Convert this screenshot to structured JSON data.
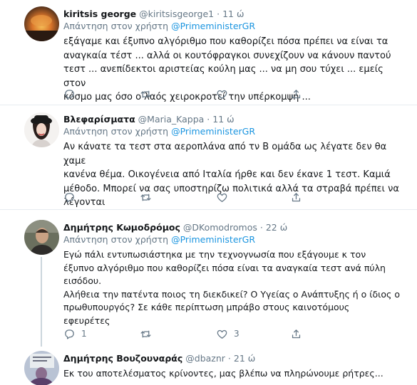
{
  "reply_prefix": "Απάντηση στον χρήστη",
  "tweets": [
    {
      "name": "kiritsis george",
      "handle": "@kiritsisgeorge1",
      "time": "11 ώ",
      "reply_to": "@PrimeministerGR",
      "lines": [
        "εξάγαμε και έξυπνο αλγόριθμο που καθορίζει πόσα πρέπει να είναι τα",
        "αναγκαία τέστ ... αλλά οι κουτόφραγκοι συνεχίζουν να κάνουν παντού",
        "τεστ ... ανεπίδεκτοι αριστείας κούλη μας ... να μη σου τύχει ... εμείς στον",
        "κόσμο μας  όσο ο λαός χειροκροτεί την υπέρκομψη ..."
      ],
      "counts": {
        "replies": "",
        "retweets": "",
        "likes": ""
      }
    },
    {
      "name": "Βλεφαρίσματα",
      "handle": "@Maria_Kappa",
      "time": "11 ώ",
      "reply_to": "@PrimeministerGR",
      "lines": [
        "Αν κάνατε τα τεστ στα αεροπλάνα από τν Β ομάδα ως λέγατε δεν θα χαμε",
        "κανένα θέμα. Οικογένεια από Ιταλία ήρθε και δεν έκανε 1 τεστ. Καμιά",
        "μέθοδο. Μπορεί να σας υποστηρίζω πολιτικά αλλά τα στραβά πρέπει να",
        "λέγονται"
      ],
      "counts": {
        "replies": "",
        "retweets": "",
        "likes": ""
      }
    },
    {
      "name": "Δημήτρης Κωμοδρόμος",
      "handle": "@DKomodromos",
      "time": "22 ώ",
      "reply_to": "@PrimeministerGR",
      "lines": [
        "Εγώ πάλι εντυπωσιάστηκα με την τεχνογνωσία που εξάγουμε  κ τον",
        "έξυπνο αλγόριθμο που καθορίζει πόσα είναι τα αναγκαία τεστ ανά πύλη",
        "εισόδου.",
        "Αλήθεια την πατέντα ποιος τη διεκδικεί? Ο Υγείας ο Ανάπτυξης ή ο ίδιος ο",
        "πρωθυπουργός? Σε κάθε περίπτωση μπράβο στους καινοτόμους",
        "εφευρέτες"
      ],
      "counts": {
        "replies": "1",
        "retweets": "",
        "likes": "3"
      }
    },
    {
      "name": "Δημήτρης Βουζουναράς",
      "handle": "@dbaznr",
      "time": "21 ώ",
      "lines": [
        "Εκ του αποτελέσματος κρίνοντες, μας βλέπω να πληρώνουμε ρήτρες..."
      ]
    }
  ],
  "icons": {
    "reply": "reply-icon",
    "retweet": "retweet-icon",
    "like": "heart-icon",
    "share": "share-icon"
  },
  "colors": {
    "link": "#1b95e0",
    "secondary_text": "#657786",
    "divider": "#e6ecf0"
  }
}
